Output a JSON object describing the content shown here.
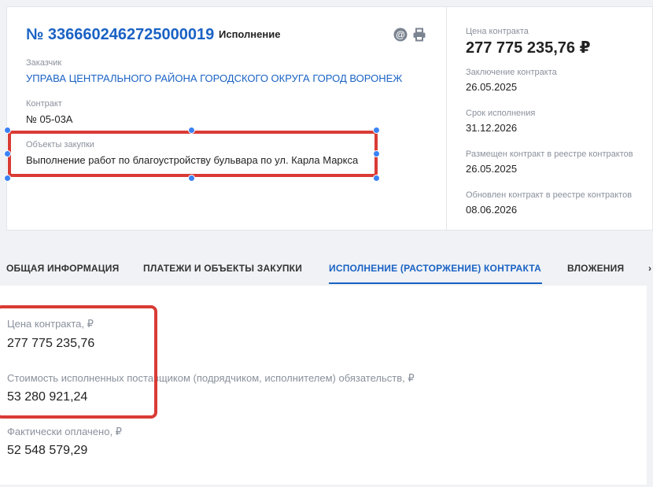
{
  "header": {
    "number": "№ 3366602462725000019",
    "status": "Исполнение",
    "customer_label": "Заказчик",
    "customer_value": "УПРАВА ЦЕНТРАЛЬНОГО РАЙОНА ГОРОДСКОГО ОКРУГА ГОРОД ВОРОНЕЖ",
    "contract_label": "Контракт",
    "contract_value": "№ 05-03А",
    "objects_label": "Объекты закупки",
    "objects_value": "Выполнение работ по благоустройству бульвара по ул. Карла Маркса"
  },
  "icons": {
    "email": "@",
    "print": "⎙"
  },
  "side": {
    "price_label": "Цена контракта",
    "price_value": "277 775 235,76 ₽",
    "conclusion_label": "Заключение контракта",
    "conclusion_value": "26.05.2025",
    "term_label": "Срок исполнения",
    "term_value": "31.12.2026",
    "placed_label": "Размещен контракт в реестре контрактов",
    "placed_value": "26.05.2025",
    "updated_label": "Обновлен контракт в реестре контрактов",
    "updated_value": "08.06.2026"
  },
  "tabs": [
    {
      "label": "ОБЩАЯ ИНФОРМАЦИЯ"
    },
    {
      "label": "ПЛАТЕЖИ И ОБЪЕКТЫ ЗАКУПКИ"
    },
    {
      "label": "ИСПОЛНЕНИЕ (РАСТОРЖЕНИЕ) КОНТРАКТА",
      "active": true
    },
    {
      "label": "ВЛОЖЕНИЯ"
    }
  ],
  "tabs_more": "›",
  "execution": {
    "price_label": "Цена контракта, ₽",
    "price_value": "277 775 235,76",
    "fulfilled_label": "Стоимость исполненных поставщиком (подрядчиком, исполнителем) обязательств, ₽",
    "fulfilled_value": "53 280 921,24",
    "paid_label": "Фактически оплачено, ₽",
    "paid_value": "52 548 579,29"
  },
  "colors": {
    "accent": "#1a62c4",
    "highlight": "#d93b35",
    "handle": "#3b82f6"
  }
}
